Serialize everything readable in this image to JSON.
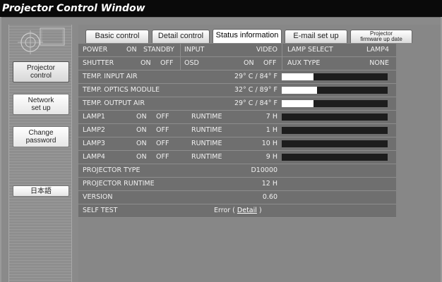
{
  "window": {
    "title": "Projector Control Window"
  },
  "sidebar": {
    "items": [
      {
        "label": "Projector\ncontrol",
        "active": true
      },
      {
        "label": "Network\nset up",
        "active": false
      },
      {
        "label": "Change\npassword",
        "active": false
      },
      {
        "label": "日本語",
        "active": false
      }
    ]
  },
  "tabs": [
    {
      "label": "Basic control",
      "active": false
    },
    {
      "label": "Detail control",
      "active": false
    },
    {
      "label": "Status information",
      "active": true
    },
    {
      "label": "E-mail set up",
      "active": false
    },
    {
      "label": "Projector\nfirmware up date",
      "active": false
    }
  ],
  "status": {
    "row1": {
      "power_label": "POWER",
      "power_on": "ON",
      "power_standby": "STANDBY",
      "input_label": "INPUT",
      "input_value": "VIDEO",
      "lamp_select_label": "LAMP SELECT",
      "lamp_select_value": "LAMP4"
    },
    "row2": {
      "shutter_label": "SHUTTER",
      "shutter_on": "ON",
      "shutter_off": "OFF",
      "osd_label": "OSD",
      "osd_on": "ON",
      "osd_off": "OFF",
      "aux_type_label": "AUX TYPE",
      "aux_type_value": "NONE"
    },
    "temps": [
      {
        "label": "TEMP. INPUT AIR",
        "value": "29° C / 84° F",
        "level": 0.3
      },
      {
        "label": "TEMP. OPTICS MODULE",
        "value": "32° C / 89° F",
        "level": 0.33
      },
      {
        "label": "TEMP. OUTPUT AIR",
        "value": "29° C / 84° F",
        "level": 0.3
      }
    ],
    "lamps": [
      {
        "label": "LAMP1",
        "on": "ON",
        "off": "OFF",
        "runtime_label": "RUNTIME",
        "runtime": "7 H",
        "level": 0
      },
      {
        "label": "LAMP2",
        "on": "ON",
        "off": "OFF",
        "runtime_label": "RUNTIME",
        "runtime": "1 H",
        "level": 0
      },
      {
        "label": "LAMP3",
        "on": "ON",
        "off": "OFF",
        "runtime_label": "RUNTIME",
        "runtime": "10 H",
        "level": 0
      },
      {
        "label": "LAMP4",
        "on": "ON",
        "off": "OFF",
        "runtime_label": "RUNTIME",
        "runtime": "9 H",
        "level": 0
      }
    ],
    "projector_type": {
      "label": "PROJECTOR TYPE",
      "value": "D10000"
    },
    "projector_runtime": {
      "label": "PROJECTOR RUNTIME",
      "value": "12 H"
    },
    "version": {
      "label": "VERSION",
      "value": "0.60"
    },
    "self_test": {
      "label": "SELF TEST",
      "prefix": "Error (",
      "link": "Detail",
      "suffix": ")"
    }
  }
}
